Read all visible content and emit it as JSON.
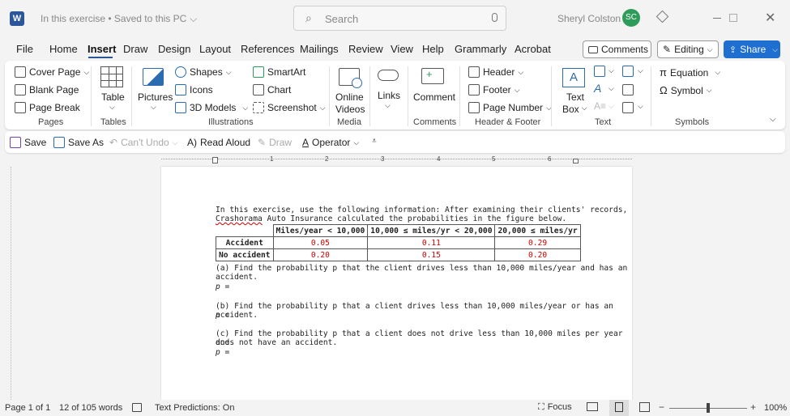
{
  "titlebar": {
    "doc_title": "In this exercise • Saved to this PC",
    "search_placeholder": "Search",
    "user_name": "Sheryl Colston",
    "user_initials": "SC"
  },
  "menu": {
    "tabs": [
      "File",
      "Home",
      "Insert",
      "Draw",
      "Design",
      "Layout",
      "References",
      "Mailings",
      "Review",
      "View",
      "Help",
      "Grammarly",
      "Acrobat"
    ],
    "active": "Insert",
    "comments_label": "Comments",
    "editing_label": "Editing",
    "share_label": "Share"
  },
  "ribbon": {
    "pages": {
      "cover_page": "Cover Page",
      "blank_page": "Blank Page",
      "page_break": "Page Break",
      "group": "Pages"
    },
    "tables": {
      "table": "Table",
      "group": "Tables"
    },
    "illustrations": {
      "pictures": "Pictures",
      "shapes": "Shapes",
      "icons": "Icons",
      "models": "3D Models",
      "smartart": "SmartArt",
      "chart": "Chart",
      "screenshot": "Screenshot",
      "group": "Illustrations"
    },
    "media": {
      "online": "Online",
      "videos": "Videos",
      "group": "Media"
    },
    "links": {
      "links": "Links"
    },
    "comments": {
      "comment": "Comment",
      "group": "Comments"
    },
    "header_footer": {
      "header": "Header",
      "footer": "Footer",
      "page_number": "Page Number",
      "group": "Header & Footer"
    },
    "text": {
      "text": "Text",
      "box": "Box",
      "group": "Text"
    },
    "symbols": {
      "equation": "Equation",
      "symbol": "Symbol",
      "group": "Symbols"
    }
  },
  "qat": {
    "save": "Save",
    "save_as": "Save As",
    "cant_undo": "Can't Undo",
    "read_aloud": "Read Aloud",
    "draw": "Draw",
    "operator": "Operator"
  },
  "ruler": {
    "marks": [
      "1",
      "2",
      "3",
      "4",
      "5",
      "6"
    ]
  },
  "document": {
    "intro_1": "In this exercise, use the following information: After examining their clients' records,",
    "intro_2_word": "Crashorama",
    "intro_2_rest": " Auto Insurance calculated the probabilities in the figure below.",
    "table": {
      "headers": [
        "",
        "Miles/year < 10,000",
        "10,000 ≤ miles/yr < 20,000",
        "20,000 ≤ miles/yr"
      ],
      "rows": [
        {
          "label": "Accident",
          "values": [
            "0.05",
            "0.11",
            "0.29"
          ]
        },
        {
          "label": "No accident",
          "values": [
            "0.20",
            "0.15",
            "0.20"
          ]
        }
      ]
    },
    "qa_1": "(a) Find the probability p that the client drives less than 10,000 miles/year and has an",
    "qa_2": "accident.",
    "pa": "p =",
    "qb": "(b) Find the probability p that a client drives less than 10,000 miles/year or has an accident.",
    "pb": "p =",
    "qc_1": "(c) Find the probability p that a client does not drive less than 10,000 miles per year and",
    "qc_2": "does not have an accident.",
    "pc": "p ="
  },
  "status": {
    "page": "Page 1 of 1",
    "words": "12 of 105 words",
    "predictions": "Text Predictions: On",
    "focus": "Focus",
    "zoom": "100%"
  },
  "colors": {
    "accent": "#2b579a",
    "share": "#1f6fd1",
    "value_red": "#d40000",
    "avatar": "#2e9b5a"
  }
}
